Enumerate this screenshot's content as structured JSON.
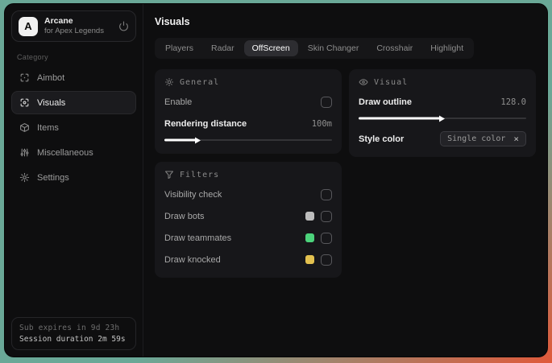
{
  "sidebar": {
    "logo": {
      "letter": "A",
      "title": "Arcane",
      "subtitle": "for Apex Legends"
    },
    "section_label": "Category",
    "items": [
      {
        "label": "Aimbot",
        "icon": "crosshair-scan-icon"
      },
      {
        "label": "Visuals",
        "icon": "scan-eye-icon",
        "active": true
      },
      {
        "label": "Items",
        "icon": "box-icon"
      },
      {
        "label": "Miscellaneous",
        "icon": "sliders-icon"
      },
      {
        "label": "Settings",
        "icon": "gear-icon"
      }
    ],
    "footer": {
      "line1": "Sub expires in 9d 23h",
      "line2": "Session duration 2m 59s"
    }
  },
  "main": {
    "title": "Visuals",
    "tabs": [
      {
        "label": "Players"
      },
      {
        "label": "Radar"
      },
      {
        "label": "OffScreen",
        "active": true
      },
      {
        "label": "Skin Changer"
      },
      {
        "label": "Crosshair"
      },
      {
        "label": "Highlight"
      }
    ],
    "panels": {
      "general": {
        "title": "General",
        "enable": {
          "label": "Enable",
          "checked": false
        },
        "rendering_distance": {
          "label": "Rendering distance",
          "value": "100m",
          "slider_fill": "20%"
        }
      },
      "filters": {
        "title": "Filters",
        "rows": [
          {
            "label": "Visibility check",
            "checked": false
          },
          {
            "label": "Draw bots",
            "swatch": "#bdbdbd",
            "checked": false
          },
          {
            "label": "Draw teammates",
            "swatch": "#4cd37b",
            "checked": false
          },
          {
            "label": "Draw knocked",
            "swatch": "#e3c14f",
            "checked": false
          }
        ]
      },
      "visual": {
        "title": "Visual",
        "draw_outline": {
          "label": "Draw outline",
          "value": "128.0",
          "slider_fill": "50%"
        },
        "style_color": {
          "label": "Style color",
          "chip_label": "Single color",
          "chip_remove": "×"
        }
      }
    }
  },
  "colors": {
    "desktop_teal": "#6aa897",
    "desktop_orange": "#e0593a",
    "window_bg": "#0e0e0f",
    "panel_bg": "#17171a",
    "accent_white": "#ffffff",
    "swatch_bots": "#bdbdbd",
    "swatch_teammates": "#4cd37b",
    "swatch_knocked": "#e3c14f"
  }
}
